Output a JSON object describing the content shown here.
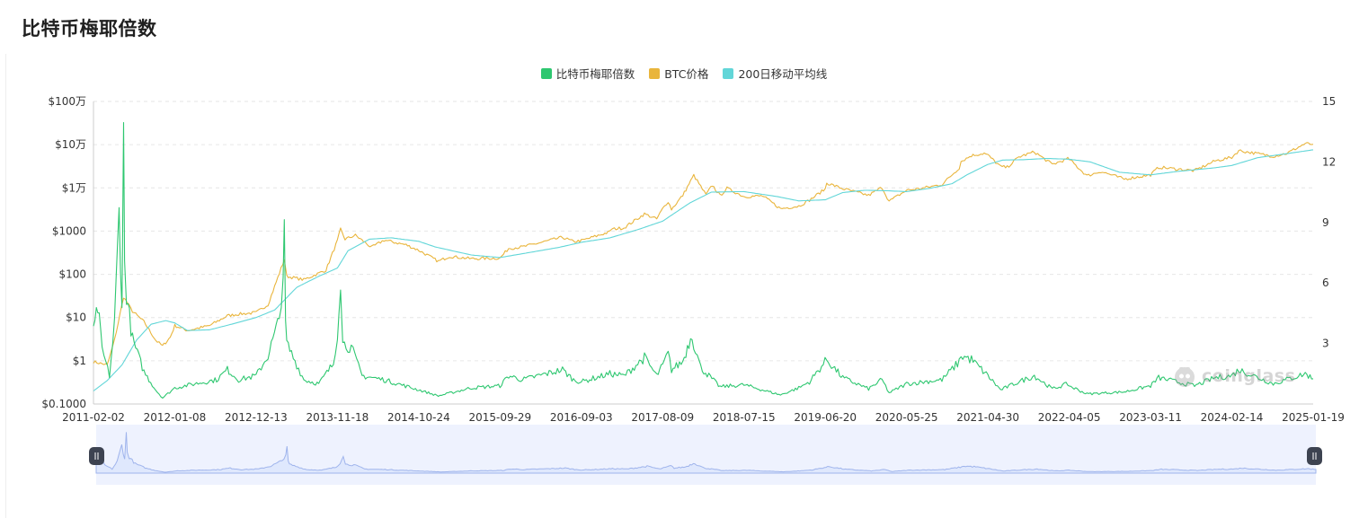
{
  "page": {
    "title": "比特币梅耶倍数"
  },
  "watermark": {
    "text": "coinglass"
  },
  "colors": {
    "mayer": "#2ec770",
    "price": "#e9b53c",
    "ma200": "#62d6d8",
    "navigator_fill": "#dfe8fd",
    "navigator_line": "#9fb4ec",
    "grid": "#e6e6e6"
  },
  "chart_data": {
    "type": "line",
    "title": "比特币梅耶倍数",
    "legend_position": "top-center",
    "legend": [
      "比特币梅耶倍数",
      "BTC价格",
      "200日移动平均线"
    ],
    "x_start": "2011-02-02",
    "x_end": "2025-01-19",
    "x_ticks": [
      "2011-02-02",
      "2012-01-08",
      "2012-12-13",
      "2013-11-18",
      "2014-10-24",
      "2015-09-29",
      "2016-09-03",
      "2017-08-09",
      "2018-07-15",
      "2019-06-20",
      "2020-05-25",
      "2021-04-30",
      "2022-04-05",
      "2023-03-11",
      "2024-02-14",
      "2025-01-19"
    ],
    "y_left": {
      "scale": "log",
      "range": [
        0.1,
        1000000
      ],
      "tick_labels": [
        "$0.1000",
        "$1",
        "$10",
        "$100",
        "$1000",
        "$1万",
        "$10万",
        "$100万"
      ]
    },
    "y_right": {
      "scale": "linear",
      "range": [
        0,
        15
      ],
      "tick_labels": [
        "3",
        "6",
        "9",
        "12",
        "15"
      ]
    },
    "grid": "horizontal-dashed",
    "series": [
      {
        "name": "BTC价格",
        "axis": "left",
        "points": [
          [
            "2011-02-02",
            0.95
          ],
          [
            "2011-04-01",
            0.8
          ],
          [
            "2011-05-01",
            3
          ],
          [
            "2011-06-08",
            30
          ],
          [
            "2011-07-15",
            14
          ],
          [
            "2011-09-01",
            8
          ],
          [
            "2011-10-20",
            3
          ],
          [
            "2011-11-18",
            2.2
          ],
          [
            "2011-12-20",
            3.5
          ],
          [
            "2012-01-08",
            6.5
          ],
          [
            "2012-03-01",
            5
          ],
          [
            "2012-06-01",
            6.5
          ],
          [
            "2012-08-15",
            11
          ],
          [
            "2012-10-01",
            12
          ],
          [
            "2012-12-13",
            13
          ],
          [
            "2013-02-01",
            20
          ],
          [
            "2013-04-10",
            220
          ],
          [
            "2013-04-20",
            90
          ],
          [
            "2013-07-01",
            75
          ],
          [
            "2013-10-01",
            125
          ],
          [
            "2013-11-18",
            600
          ],
          [
            "2013-12-01",
            1100
          ],
          [
            "2013-12-20",
            650
          ],
          [
            "2014-02-01",
            800
          ],
          [
            "2014-04-10",
            420
          ],
          [
            "2014-06-01",
            620
          ],
          [
            "2014-09-01",
            480
          ],
          [
            "2014-10-24",
            360
          ],
          [
            "2015-01-14",
            200
          ],
          [
            "2015-03-01",
            260
          ],
          [
            "2015-06-01",
            230
          ],
          [
            "2015-09-29",
            237
          ],
          [
            "2015-11-04",
            400
          ],
          [
            "2016-01-01",
            430
          ],
          [
            "2016-06-16",
            720
          ],
          [
            "2016-08-01",
            570
          ],
          [
            "2016-09-03",
            600
          ],
          [
            "2016-12-31",
            960
          ],
          [
            "2017-01-05",
            1100
          ],
          [
            "2017-03-01",
            1200
          ],
          [
            "2017-05-25",
            2500
          ],
          [
            "2017-07-15",
            1900
          ],
          [
            "2017-08-09",
            3300
          ],
          [
            "2017-09-01",
            4900
          ],
          [
            "2017-09-15",
            3200
          ],
          [
            "2017-11-01",
            6700
          ],
          [
            "2017-12-17",
            19500
          ],
          [
            "2018-02-06",
            6900
          ],
          [
            "2018-03-05",
            11500
          ],
          [
            "2018-04-06",
            6600
          ],
          [
            "2018-05-05",
            9800
          ],
          [
            "2018-07-15",
            6300
          ],
          [
            "2018-10-01",
            6500
          ],
          [
            "2018-12-15",
            3300
          ],
          [
            "2019-03-01",
            3800
          ],
          [
            "2019-04-15",
            5200
          ],
          [
            "2019-06-20",
            9500
          ],
          [
            "2019-06-26",
            13000
          ],
          [
            "2019-09-01",
            9600
          ],
          [
            "2019-12-18",
            6700
          ],
          [
            "2020-02-12",
            10300
          ],
          [
            "2020-03-13",
            4900
          ],
          [
            "2020-05-25",
            8800
          ],
          [
            "2020-07-25",
            9700
          ],
          [
            "2020-10-20",
            12000
          ],
          [
            "2020-12-31",
            29000
          ],
          [
            "2021-01-08",
            41000
          ],
          [
            "2021-02-20",
            56000
          ],
          [
            "2021-04-14",
            63000
          ],
          [
            "2021-04-30",
            57000
          ],
          [
            "2021-06-22",
            31000
          ],
          [
            "2021-07-20",
            30000
          ],
          [
            "2021-09-06",
            52000
          ],
          [
            "2021-11-10",
            68000
          ],
          [
            "2022-01-24",
            35000
          ],
          [
            "2022-03-30",
            47000
          ],
          [
            "2022-04-05",
            46000
          ],
          [
            "2022-06-18",
            19000
          ],
          [
            "2022-08-15",
            24000
          ],
          [
            "2022-11-21",
            16000
          ],
          [
            "2023-03-11",
            20000
          ],
          [
            "2023-04-14",
            30000
          ],
          [
            "2023-09-11",
            25000
          ],
          [
            "2023-12-05",
            42000
          ],
          [
            "2024-02-14",
            51000
          ],
          [
            "2024-03-14",
            73000
          ],
          [
            "2024-08-05",
            54000
          ],
          [
            "2024-10-01",
            63000
          ],
          [
            "2024-12-17",
            106000
          ],
          [
            "2025-01-19",
            102000
          ]
        ]
      },
      {
        "name": "200日移动平均线",
        "axis": "left",
        "points": [
          [
            "2011-02-02",
            0.2
          ],
          [
            "2011-04-01",
            0.35
          ],
          [
            "2011-06-01",
            0.8
          ],
          [
            "2011-08-01",
            3
          ],
          [
            "2011-10-01",
            7
          ],
          [
            "2011-12-01",
            8.5
          ],
          [
            "2012-01-08",
            7.5
          ],
          [
            "2012-03-01",
            5
          ],
          [
            "2012-06-01",
            5.2
          ],
          [
            "2012-09-01",
            7
          ],
          [
            "2012-12-13",
            10
          ],
          [
            "2013-03-01",
            15
          ],
          [
            "2013-06-01",
            50
          ],
          [
            "2013-09-01",
            90
          ],
          [
            "2013-11-18",
            140
          ],
          [
            "2014-01-01",
            350
          ],
          [
            "2014-04-01",
            650
          ],
          [
            "2014-07-01",
            700
          ],
          [
            "2014-10-24",
            580
          ],
          [
            "2015-01-01",
            430
          ],
          [
            "2015-06-01",
            280
          ],
          [
            "2015-09-29",
            245
          ],
          [
            "2016-01-01",
            300
          ],
          [
            "2016-06-01",
            420
          ],
          [
            "2016-09-03",
            550
          ],
          [
            "2017-01-01",
            700
          ],
          [
            "2017-05-01",
            1100
          ],
          [
            "2017-08-09",
            1700
          ],
          [
            "2017-12-01",
            4500
          ],
          [
            "2018-03-01",
            8000
          ],
          [
            "2018-07-15",
            8200
          ],
          [
            "2018-12-01",
            6300
          ],
          [
            "2019-03-01",
            5000
          ],
          [
            "2019-06-20",
            5300
          ],
          [
            "2019-09-01",
            7800
          ],
          [
            "2019-12-01",
            8800
          ],
          [
            "2020-03-01",
            8600
          ],
          [
            "2020-05-25",
            8200
          ],
          [
            "2020-09-01",
            9800
          ],
          [
            "2020-12-01",
            12500
          ],
          [
            "2021-02-01",
            20000
          ],
          [
            "2021-04-30",
            35000
          ],
          [
            "2021-07-01",
            44000
          ],
          [
            "2021-10-01",
            45000
          ],
          [
            "2022-01-01",
            48000
          ],
          [
            "2022-04-05",
            46000
          ],
          [
            "2022-07-01",
            40000
          ],
          [
            "2022-11-01",
            23000
          ],
          [
            "2023-03-11",
            20000
          ],
          [
            "2023-07-01",
            24000
          ],
          [
            "2023-12-01",
            29000
          ],
          [
            "2024-02-14",
            33000
          ],
          [
            "2024-06-01",
            50000
          ],
          [
            "2024-10-01",
            62000
          ],
          [
            "2025-01-19",
            76000
          ]
        ]
      },
      {
        "name": "比特币梅耶倍数",
        "axis": "right",
        "points": [
          [
            "2011-02-02",
            3.5
          ],
          [
            "2011-02-20",
            4.8
          ],
          [
            "2011-03-10",
            2.7
          ],
          [
            "2011-04-10",
            1.4
          ],
          [
            "2011-05-01",
            4
          ],
          [
            "2011-05-20",
            9.5
          ],
          [
            "2011-06-01",
            5
          ],
          [
            "2011-06-08",
            13.2
          ],
          [
            "2011-06-12",
            7
          ],
          [
            "2011-06-20",
            5.5
          ],
          [
            "2011-07-15",
            3.2
          ],
          [
            "2011-09-01",
            1.6
          ],
          [
            "2011-10-20",
            0.7
          ],
          [
            "2011-11-18",
            0.3
          ],
          [
            "2012-01-08",
            0.8
          ],
          [
            "2012-04-01",
            1.0
          ],
          [
            "2012-07-01",
            1.2
          ],
          [
            "2012-08-15",
            1.7
          ],
          [
            "2012-10-01",
            1.2
          ],
          [
            "2012-12-13",
            1.4
          ],
          [
            "2013-02-01",
            2.4
          ],
          [
            "2013-03-20",
            4.2
          ],
          [
            "2013-04-05",
            6.5
          ],
          [
            "2013-04-10",
            8.3
          ],
          [
            "2013-04-15",
            4
          ],
          [
            "2013-04-20",
            3
          ],
          [
            "2013-05-10",
            2.5
          ],
          [
            "2013-07-01",
            1.2
          ],
          [
            "2013-09-01",
            1.0
          ],
          [
            "2013-11-01",
            2.0
          ],
          [
            "2013-11-18",
            3.5
          ],
          [
            "2013-12-01",
            6.3
          ],
          [
            "2013-12-10",
            3.0
          ],
          [
            "2014-01-15",
            2.8
          ],
          [
            "2014-03-01",
            1.4
          ],
          [
            "2014-06-01",
            1.2
          ],
          [
            "2014-10-24",
            0.7
          ],
          [
            "2015-01-14",
            0.4
          ],
          [
            "2015-06-01",
            0.8
          ],
          [
            "2015-09-29",
            0.9
          ],
          [
            "2015-11-04",
            1.4
          ],
          [
            "2016-01-01",
            1.2
          ],
          [
            "2016-06-16",
            1.7
          ],
          [
            "2016-08-01",
            1.2
          ],
          [
            "2016-09-03",
            1.1
          ],
          [
            "2016-12-31",
            1.5
          ],
          [
            "2017-03-01",
            1.4
          ],
          [
            "2017-05-25",
            2.3
          ],
          [
            "2017-07-15",
            1.4
          ],
          [
            "2017-08-09",
            1.9
          ],
          [
            "2017-09-01",
            2.5
          ],
          [
            "2017-09-15",
            1.7
          ],
          [
            "2017-11-01",
            2.1
          ],
          [
            "2017-12-10",
            3.5
          ],
          [
            "2017-12-17",
            3.0
          ],
          [
            "2018-01-15",
            1.8
          ],
          [
            "2018-04-06",
            0.85
          ],
          [
            "2018-07-15",
            0.95
          ],
          [
            "2018-12-15",
            0.45
          ],
          [
            "2019-03-01",
            0.8
          ],
          [
            "2019-04-15",
            1.1
          ],
          [
            "2019-06-26",
            2.2
          ],
          [
            "2019-09-01",
            1.3
          ],
          [
            "2019-12-18",
            0.75
          ],
          [
            "2020-02-12",
            1.2
          ],
          [
            "2020-03-13",
            0.55
          ],
          [
            "2020-05-25",
            1.0
          ],
          [
            "2020-10-20",
            1.2
          ],
          [
            "2020-12-31",
            2.1
          ],
          [
            "2021-01-08",
            2.4
          ],
          [
            "2021-02-20",
            2.2
          ],
          [
            "2021-04-30",
            1.4
          ],
          [
            "2021-06-22",
            0.7
          ],
          [
            "2021-09-06",
            1.1
          ],
          [
            "2021-11-10",
            1.4
          ],
          [
            "2022-01-24",
            0.75
          ],
          [
            "2022-03-30",
            1.0
          ],
          [
            "2022-04-05",
            0.9
          ],
          [
            "2022-06-18",
            0.5
          ],
          [
            "2022-11-21",
            0.6
          ],
          [
            "2023-03-11",
            0.9
          ],
          [
            "2023-04-14",
            1.3
          ],
          [
            "2023-09-11",
            0.9
          ],
          [
            "2023-12-05",
            1.3
          ],
          [
            "2024-02-14",
            1.4
          ],
          [
            "2024-03-14",
            1.7
          ],
          [
            "2024-08-05",
            1.0
          ],
          [
            "2024-12-17",
            1.5
          ],
          [
            "2025-01-19",
            1.25
          ]
        ]
      }
    ]
  }
}
